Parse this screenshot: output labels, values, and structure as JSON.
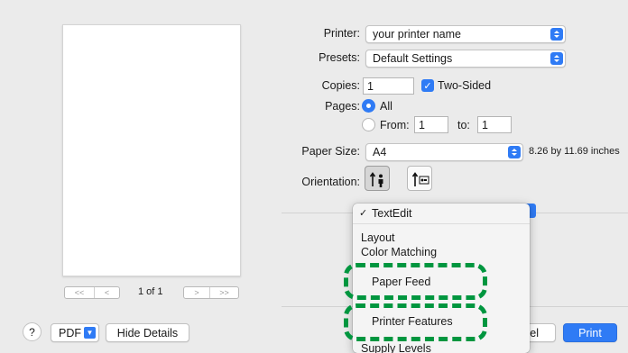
{
  "preview": {
    "page_indicator": "1 of 1",
    "first_page": "<<",
    "prev_page": "<",
    "next_page": ">",
    "last_page": ">>"
  },
  "printer": {
    "label": "Printer:",
    "value": "your printer name"
  },
  "presets": {
    "label": "Presets:",
    "value": "Default Settings"
  },
  "copies": {
    "label": "Copies:",
    "value": "1",
    "two_sided_label": "Two-Sided",
    "two_sided_checked": true
  },
  "pages": {
    "label": "Pages:",
    "all_label": "All",
    "from_label": "From:",
    "from_value": "1",
    "to_label": "to:",
    "to_value": "1",
    "selected": "All"
  },
  "paper_size": {
    "label": "Paper Size:",
    "value": "A4",
    "dimensions": "8.26 by 11.69 inches"
  },
  "orientation": {
    "label": "Orientation:",
    "selected": "portrait"
  },
  "dropdown_menu": {
    "checked_item": "✓",
    "items": [
      "TextEdit",
      "Layout",
      "Color Matching",
      "Paper Feed",
      "Printer Features",
      "Supply Levels"
    ],
    "highlighted": [
      "Paper Feed",
      "Printer Features"
    ]
  },
  "footer": {
    "help": "?",
    "pdf_label": "PDF",
    "hide_details": "Hide Details",
    "cancel_partial": "cel",
    "print": "Print"
  },
  "colors": {
    "accent": "#2f7bf5",
    "highlight": "#00963f",
    "background": "#ebebeb"
  }
}
